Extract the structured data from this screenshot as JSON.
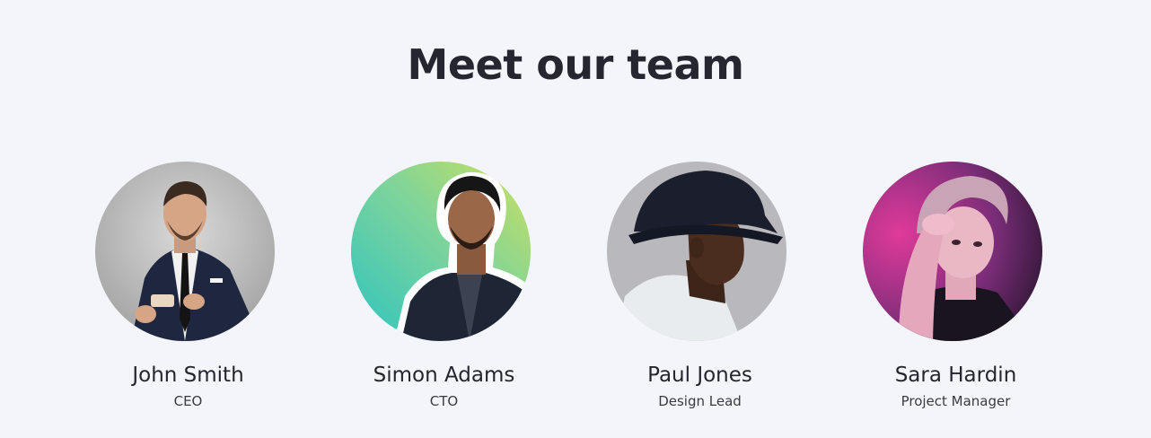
{
  "section": {
    "title": "Meet our team"
  },
  "team": [
    {
      "name": "John Smith",
      "role": "CEO",
      "avatar_icon": "person-photo"
    },
    {
      "name": "Simon Adams",
      "role": "CTO",
      "avatar_icon": "person-photo"
    },
    {
      "name": "Paul Jones",
      "role": "Design Lead",
      "avatar_icon": "person-photo"
    },
    {
      "name": "Sara Hardin",
      "role": "Project Manager",
      "avatar_icon": "person-photo"
    }
  ],
  "colors": {
    "page_background": "#f4f5fa",
    "heading_text": "#262631",
    "body_text": "#25252f"
  }
}
